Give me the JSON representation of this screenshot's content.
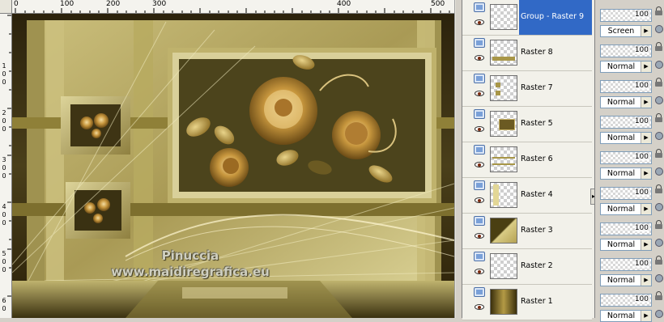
{
  "ruler": {
    "top_labels": [
      "0",
      "100",
      "200",
      "300",
      "400",
      "500"
    ],
    "left_labels": [
      "1",
      "0",
      "0",
      "2",
      "0",
      "0",
      "3",
      "0",
      "0",
      "4",
      "0",
      "0",
      "5",
      "0",
      "0",
      "6",
      "0"
    ]
  },
  "canvas": {
    "watermark_line1": "Pinuccia",
    "watermark_line2": "www.maidiregrafica.eu",
    "colors": {
      "dark": "#2b230e",
      "gold": "#b9a85a",
      "light_gold": "#d9cf8e",
      "rose": "#c89a4a"
    }
  },
  "layers": [
    {
      "name": "Group - Raster 9",
      "selected": true,
      "opacity": "100",
      "blend": "Screen",
      "thumb": "transparent"
    },
    {
      "name": "Raster 8",
      "selected": false,
      "opacity": "100",
      "blend": "Normal",
      "thumb": "bar"
    },
    {
      "name": "Raster 7",
      "selected": false,
      "opacity": "100",
      "blend": "Normal",
      "thumb": "tiles"
    },
    {
      "name": "Raster 5",
      "selected": false,
      "opacity": "100",
      "blend": "Normal",
      "thumb": "image"
    },
    {
      "name": "Raster 6",
      "selected": false,
      "opacity": "100",
      "blend": "Normal",
      "thumb": "lines"
    },
    {
      "name": "Raster 4",
      "selected": false,
      "opacity": "100",
      "blend": "Normal",
      "thumb": "strip"
    },
    {
      "name": "Raster 3",
      "selected": false,
      "opacity": "100",
      "blend": "Normal",
      "thumb": "diagonal"
    },
    {
      "name": "Raster 2",
      "selected": false,
      "opacity": "100",
      "blend": "Normal",
      "thumb": "transparent"
    },
    {
      "name": "Raster 1",
      "selected": false,
      "opacity": "100",
      "blend": "Normal",
      "thumb": "gradient"
    }
  ],
  "icons": {
    "visibility": "layer-visibility-icon",
    "eye": "eye-icon",
    "lock": "lock-icon",
    "link": "link-icon",
    "dropdown": "chevron-right-icon"
  }
}
